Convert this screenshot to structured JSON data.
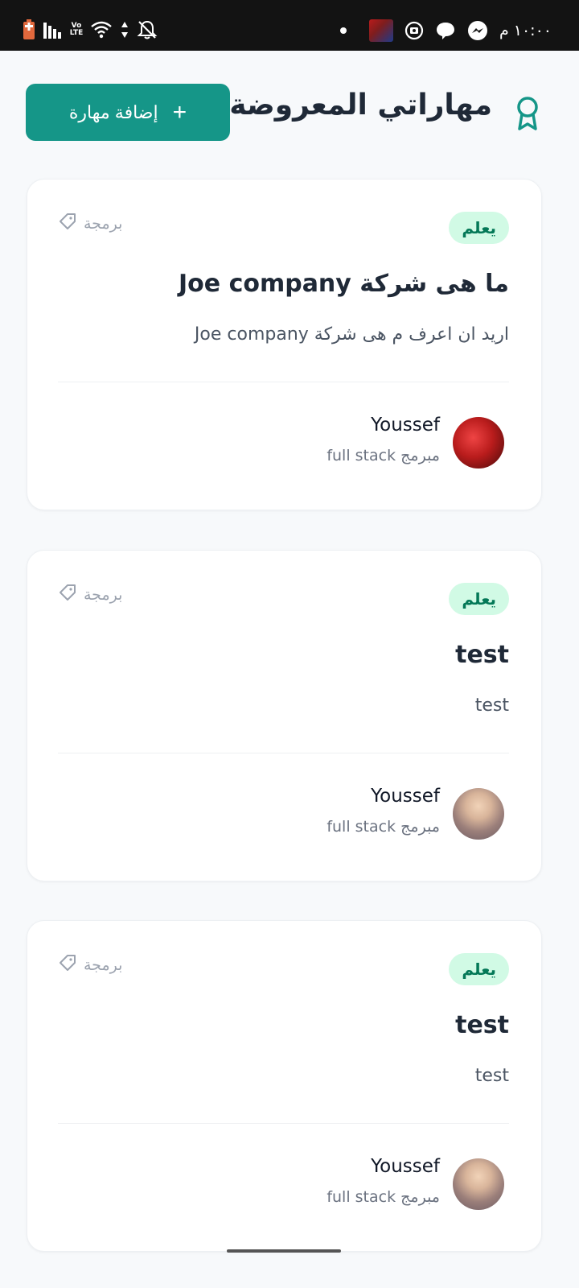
{
  "status_bar": {
    "time": "١٠:٠٠ م",
    "network_label": "Vo LTE"
  },
  "header": {
    "title": "مهاراتي المعروضة",
    "add_button_label": "إضافة مهارة",
    "add_button_icon": "+"
  },
  "cards": [
    {
      "badge": "يعلم",
      "category": "برمجة",
      "title": "ما هى شركة Joe company",
      "description": "اريد ان اعرف م هى شركة Joe company",
      "user_name": "Youssef",
      "user_role": "مبرمج full stack"
    },
    {
      "badge": "يعلم",
      "category": "برمجة",
      "title": "test",
      "description": "test",
      "user_name": "Youssef",
      "user_role": "مبرمج full stack"
    },
    {
      "badge": "يعلم",
      "category": "برمجة",
      "title": "test",
      "description": "test",
      "user_name": "Youssef",
      "user_role": "مبرمج full stack"
    }
  ],
  "colors": {
    "accent": "#159688",
    "badge_bg": "#d1fae5",
    "badge_text": "#047857"
  }
}
